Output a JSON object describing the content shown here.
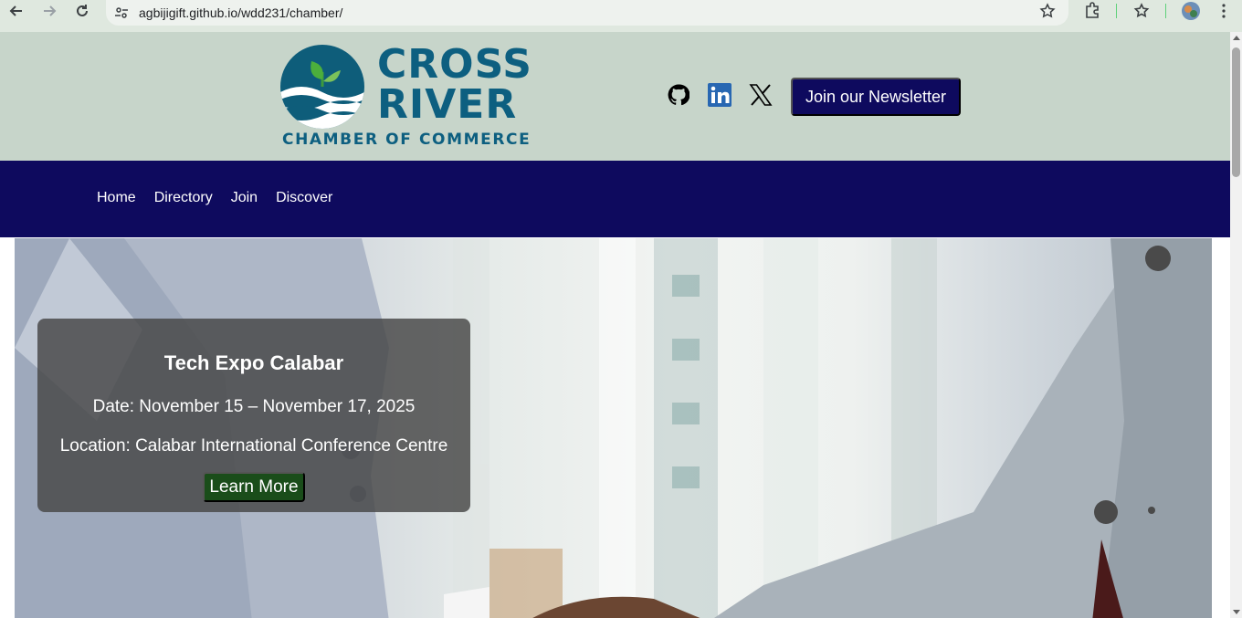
{
  "browser": {
    "url": "agbijigift.github.io/wdd231/chamber/"
  },
  "header": {
    "logo_title_line1": "CROSS",
    "logo_title_line2": "RIVER",
    "logo_subtitle": "CHAMBER OF COMMERCE",
    "newsletter_label": "Join our Newsletter",
    "social_icons": [
      "github-icon",
      "linkedin-icon",
      "x-icon"
    ]
  },
  "nav": {
    "items": [
      {
        "label": "Home"
      },
      {
        "label": "Directory"
      },
      {
        "label": "Join"
      },
      {
        "label": "Discover"
      }
    ]
  },
  "hero": {
    "event": {
      "title": "Tech Expo Calabar",
      "date": "Date: November 15 – November 17, 2025",
      "location": "Location: Calabar International Conference Centre",
      "cta_label": "Learn More"
    }
  },
  "colors": {
    "header_bg": "#c7d5ca",
    "nav_bg": "#0e0a5e",
    "brand_teal": "#0d5f80",
    "cta_green": "#1a4d1a"
  }
}
